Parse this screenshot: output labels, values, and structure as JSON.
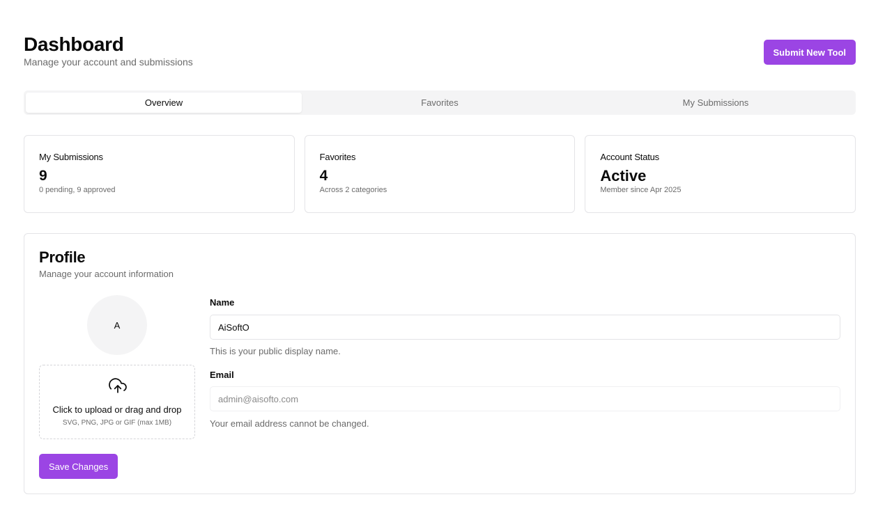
{
  "header": {
    "title": "Dashboard",
    "subtitle": "Manage your account and submissions",
    "submit_label": "Submit New Tool"
  },
  "tabs": [
    {
      "label": "Overview",
      "active": true
    },
    {
      "label": "Favorites",
      "active": false
    },
    {
      "label": "My Submissions",
      "active": false
    }
  ],
  "stats": [
    {
      "label": "My Submissions",
      "value": "9",
      "note": "0 pending, 9 approved"
    },
    {
      "label": "Favorites",
      "value": "4",
      "note": "Across 2 categories"
    },
    {
      "label": "Account Status",
      "value": "Active",
      "note": "Member since Apr 2025"
    }
  ],
  "profile": {
    "title": "Profile",
    "subtitle": "Manage your account information",
    "avatar_initial": "A",
    "upload_title": "Click to upload or drag and drop",
    "upload_note": "SVG, PNG, JPG or GIF (max 1MB)",
    "upload_icon": "cloud-upload-icon",
    "name_label": "Name",
    "name_value": "AiSoftO",
    "name_help": "This is your public display name.",
    "email_label": "Email",
    "email_value": "admin@aisofto.com",
    "email_help": "Your email address cannot be changed.",
    "save_label": "Save Changes"
  },
  "colors": {
    "accent": "#9b45e4",
    "muted_text": "#6b6b6b",
    "border": "#e4e4e7",
    "tab_bg": "#f4f4f5"
  }
}
